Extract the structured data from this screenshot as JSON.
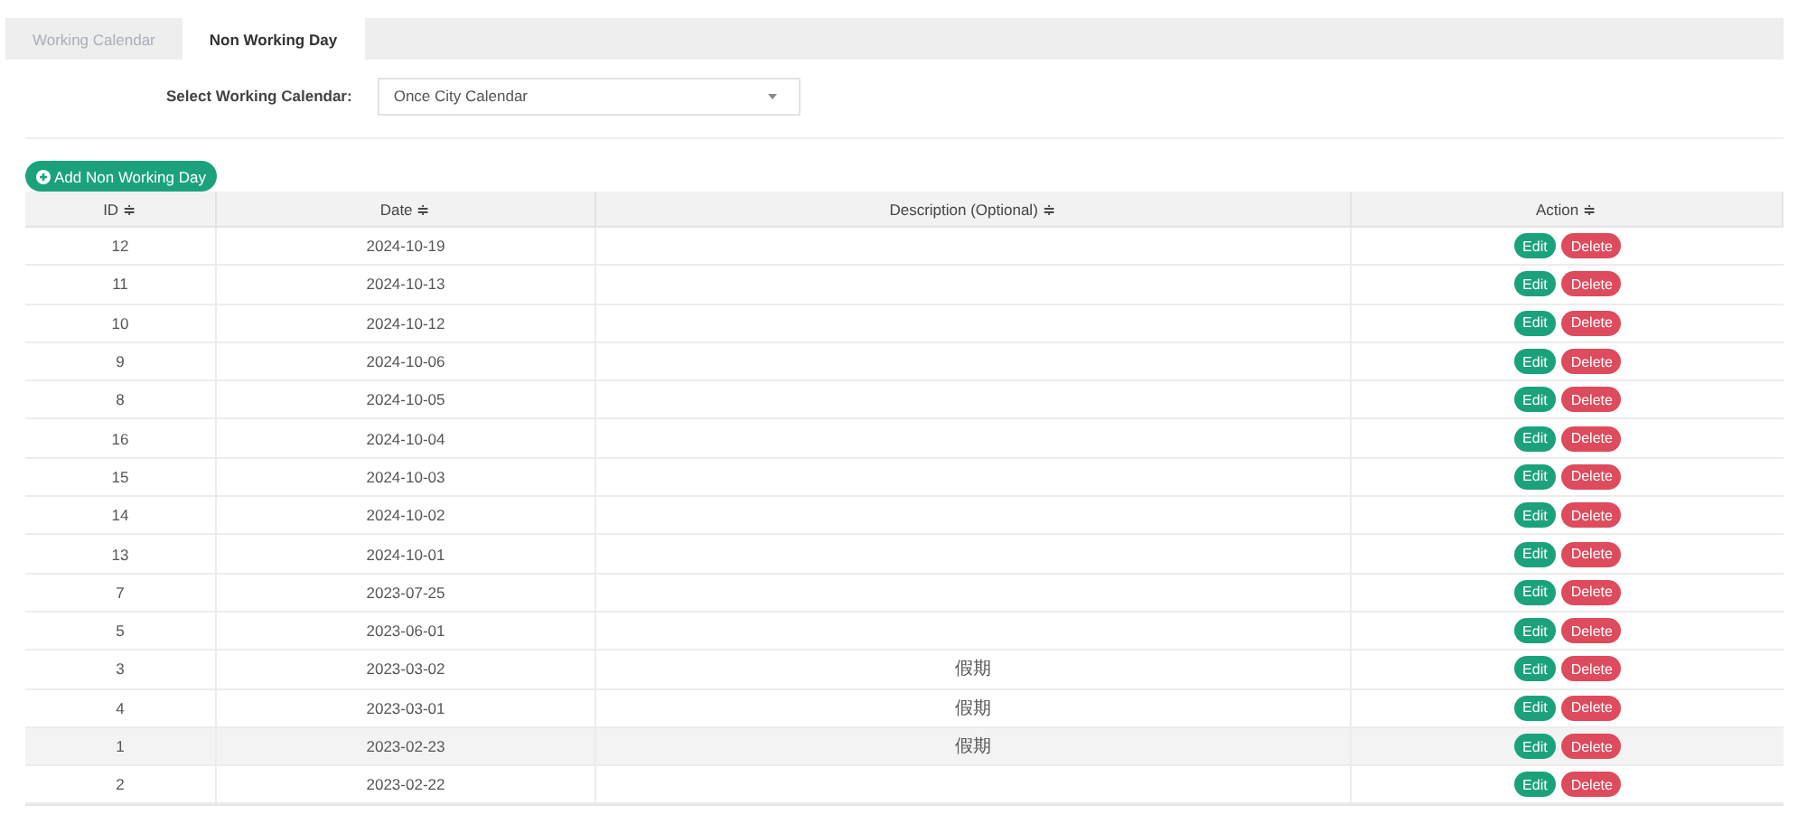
{
  "tabs": [
    {
      "label": "Working Calendar",
      "selected": false
    },
    {
      "label": "Non Working Day",
      "selected": true
    }
  ],
  "calendar_select": {
    "label": "Select Working Calendar:",
    "value": "Once City Calendar"
  },
  "add_button": {
    "label": "Add Non Working Day"
  },
  "table": {
    "columns": [
      "ID",
      "Date",
      "Description (Optional)",
      "Action"
    ],
    "sort_mark": "≑",
    "rows": [
      {
        "id": "12",
        "date": "2024-10-19",
        "highlighted": false,
        "actions": [
          "Edit",
          "Delete"
        ]
      },
      {
        "id": "11",
        "date": "2024-10-13",
        "highlighted": false,
        "actions": [
          "Edit",
          "Delete"
        ]
      },
      {
        "id": "10",
        "date": "2024-10-12",
        "highlighted": false,
        "actions": [
          "Edit",
          "Delete"
        ]
      },
      {
        "id": "9",
        "date": "2024-10-06",
        "highlighted": false,
        "actions": [
          "Edit",
          "Delete"
        ]
      },
      {
        "id": "8",
        "date": "2024-10-05",
        "highlighted": false,
        "actions": [
          "Edit",
          "Delete"
        ]
      },
      {
        "id": "16",
        "date": "2024-10-04",
        "highlighted": false,
        "actions": [
          "Edit",
          "Delete"
        ]
      },
      {
        "id": "15",
        "date": "2024-10-03",
        "highlighted": false,
        "actions": [
          "Edit",
          "Delete"
        ]
      },
      {
        "id": "14",
        "date": "2024-10-02",
        "highlighted": false,
        "actions": [
          "Edit",
          "Delete"
        ]
      },
      {
        "id": "13",
        "date": "2024-10-01",
        "highlighted": false,
        "actions": [
          "Edit",
          "Delete"
        ]
      },
      {
        "id": "7",
        "date": "2023-07-25",
        "highlighted": false,
        "actions": [
          "Edit",
          "Delete"
        ]
      },
      {
        "id": "5",
        "date": "2023-06-01",
        "highlighted": false,
        "actions": [
          "Edit",
          "Delete"
        ]
      },
      {
        "id": "3",
        "date": "2023-03-02",
        "description": "假期",
        "highlighted": false,
        "actions": [
          "Edit",
          "Delete"
        ]
      },
      {
        "id": "4",
        "date": "2023-03-01",
        "description": "假期",
        "highlighted": false,
        "actions": [
          "Edit",
          "Delete"
        ]
      },
      {
        "id": "1",
        "date": "2023-02-23",
        "description": "假期",
        "highlighted": true,
        "actions": [
          "Edit",
          "Delete"
        ]
      },
      {
        "id": "2",
        "date": "2023-02-22",
        "highlighted": false,
        "actions": [
          "Edit",
          "Delete"
        ]
      }
    ]
  }
}
